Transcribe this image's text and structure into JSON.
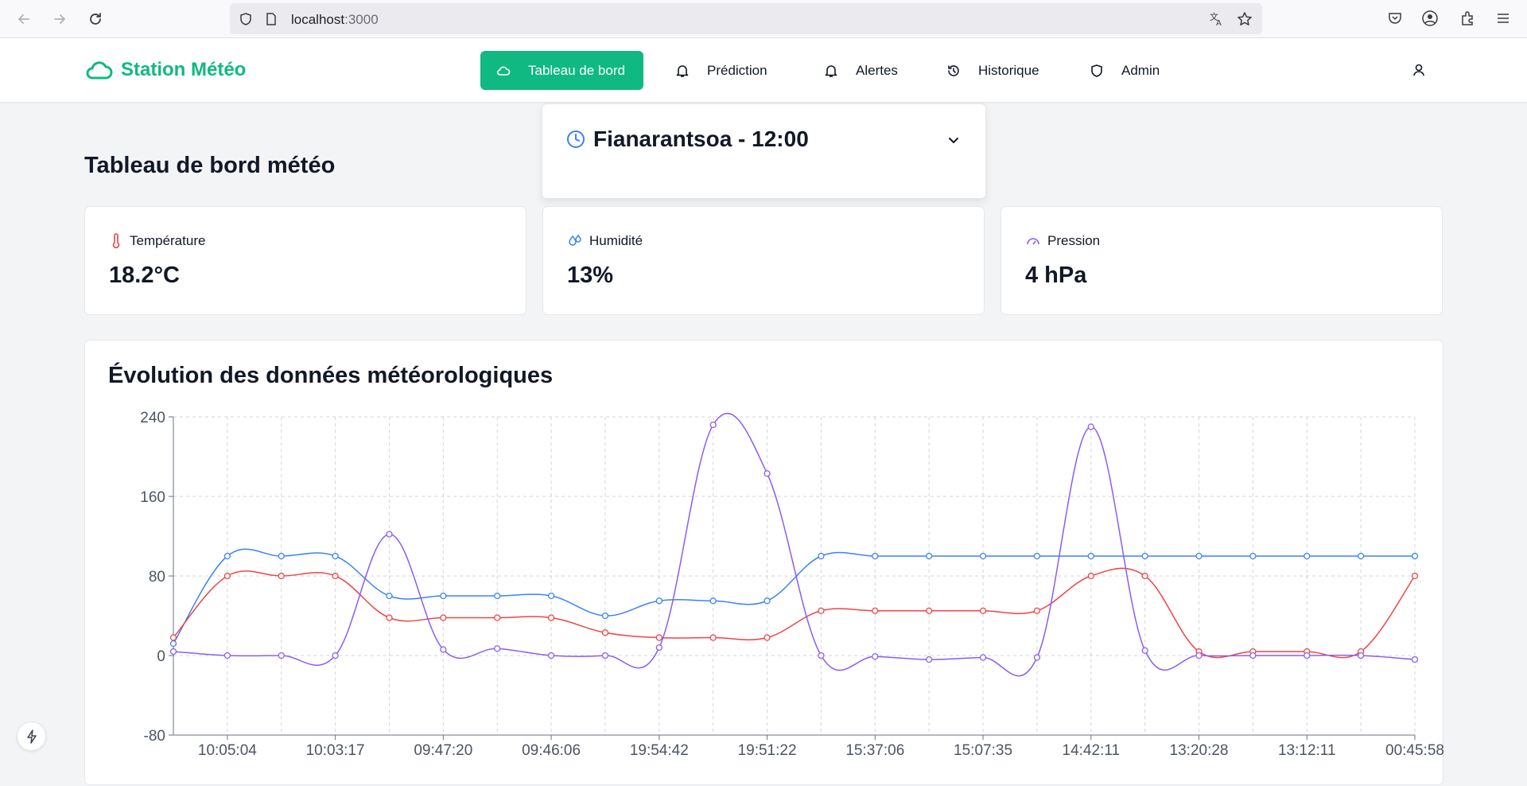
{
  "browser": {
    "url_host": "localhost",
    "url_port": ":3000"
  },
  "header": {
    "brand": "Station Météo",
    "nav": [
      {
        "label": "Tableau de bord",
        "icon": "cloud-icon",
        "active": true
      },
      {
        "label": "Prédiction",
        "icon": "bell-icon",
        "active": false
      },
      {
        "label": "Alertes",
        "icon": "bell-icon",
        "active": false
      },
      {
        "label": "Historique",
        "icon": "history-icon",
        "active": false
      },
      {
        "label": "Admin",
        "icon": "shield-icon",
        "active": false
      }
    ]
  },
  "location": {
    "label": "Fianarantsoa - 12:00"
  },
  "page": {
    "title": "Tableau de bord météo"
  },
  "metrics": [
    {
      "label": "Température",
      "value": "18.2°C",
      "icon": "thermometer-icon",
      "color": "#ef4444"
    },
    {
      "label": "Humidité",
      "value": "13%",
      "icon": "droplets-icon",
      "color": "#3b82f6"
    },
    {
      "label": "Pression",
      "value": "4 hPa",
      "icon": "gauge-icon",
      "color": "#8b5cf6"
    }
  ],
  "colors": {
    "accent": "#10b981",
    "temperature": "#ef4444",
    "humidity": "#3b82f6",
    "pressure": "#8b5cf6"
  },
  "chart_data": {
    "type": "line",
    "title": "Évolution des données météorologiques",
    "ylim": [
      -80,
      240
    ],
    "yticks": [
      -80,
      0,
      80,
      160,
      240
    ],
    "grid": true,
    "x_tick_labels": [
      "10:05:04",
      "10:03:17",
      "09:47:20",
      "09:46:06",
      "19:54:42",
      "19:51:22",
      "15:37:06",
      "15:07:35",
      "14:42:11",
      "13:20:28",
      "13:12:11",
      "00:45:58"
    ],
    "series": [
      {
        "key": "humidity",
        "color": "#3b82f6",
        "values": [
          12,
          100,
          100,
          100,
          60,
          60,
          60,
          60,
          40,
          55,
          55,
          55,
          100,
          100,
          100,
          100,
          100,
          100,
          100,
          100,
          100,
          100,
          100,
          100
        ]
      },
      {
        "key": "temperature",
        "color": "#ef4444",
        "values": [
          18,
          80,
          80,
          80,
          38,
          38,
          38,
          38,
          23,
          18,
          18,
          18,
          45,
          45,
          45,
          45,
          45,
          80,
          80,
          4,
          4,
          4,
          4,
          80
        ]
      },
      {
        "key": "pressure",
        "color": "#8b5cf6",
        "values": [
          4,
          0,
          0,
          0,
          122,
          6,
          7,
          0,
          0,
          8,
          232,
          183,
          0,
          -1,
          -4,
          -2,
          -2,
          230,
          5,
          0,
          0,
          0,
          0,
          -4
        ]
      }
    ]
  }
}
